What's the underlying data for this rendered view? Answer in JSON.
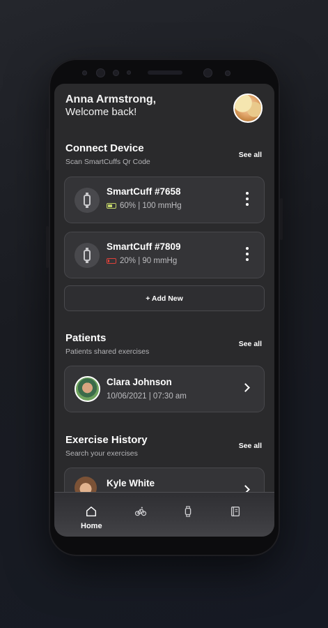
{
  "header": {
    "name": "Anna Armstrong,",
    "welcome": "Welcome back!"
  },
  "connect": {
    "title": "Connect Device",
    "subtitle": "Scan SmartCuffs Qr Code",
    "see_all": "See all",
    "devices": [
      {
        "name": "SmartCuff #7658",
        "status": "60% | 100 mmHg",
        "battery_color": "#c6d86a",
        "battery_level": 0.6
      },
      {
        "name": "SmartCuff #7809",
        "status": "20% | 90 mmHg",
        "battery_color": "#e0413a",
        "battery_level": 0.2
      }
    ],
    "add_new": "+ Add New"
  },
  "patients": {
    "title": "Patients",
    "subtitle": "Patients shared exercises",
    "see_all": "See all",
    "items": [
      {
        "name": "Clara Johnson",
        "date": "10/06/2021  |  07:30 am"
      }
    ]
  },
  "history": {
    "title": "Exercise History",
    "subtitle": "Search your exercises",
    "see_all": "See all",
    "items": [
      {
        "name": "Kyle White"
      }
    ]
  },
  "nav": {
    "items": [
      {
        "label": "Home",
        "icon": "home-icon",
        "active": true
      },
      {
        "label": "",
        "icon": "bike-icon",
        "active": false
      },
      {
        "label": "",
        "icon": "watch-icon",
        "active": false
      },
      {
        "label": "",
        "icon": "book-icon",
        "active": false
      }
    ]
  }
}
